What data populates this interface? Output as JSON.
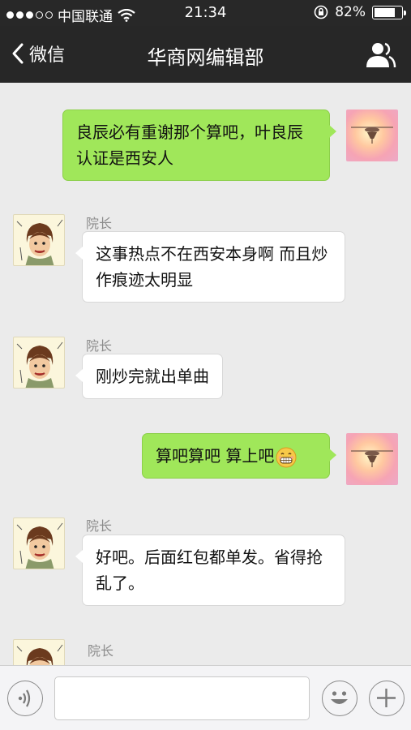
{
  "status_bar": {
    "carrier": "中国联通",
    "time": "21:34",
    "battery_percent": "82%",
    "battery_level": 0.82
  },
  "nav": {
    "back_label": "微信",
    "title": "华商网编辑部"
  },
  "messages": [
    {
      "direction": "outgoing",
      "text": "良辰必有重谢那个算吧，叶良辰认证是西安人"
    },
    {
      "direction": "incoming",
      "sender": "院长",
      "text": "这事热点不在西安本身啊 而且炒作痕迹太明显"
    },
    {
      "direction": "incoming",
      "sender": "院长",
      "text": "刚炒完就出单曲"
    },
    {
      "direction": "outgoing",
      "text": "算吧算吧 算上吧",
      "emoji": "grinning-face"
    },
    {
      "direction": "incoming",
      "sender": "院长",
      "text": "好吧。后面红包都单发。省得抢乱了。"
    },
    {
      "direction": "incoming",
      "sender": "院长",
      "text": ""
    }
  ],
  "input_bar": {
    "text_value": "",
    "icons": [
      "voice-icon",
      "emoji-icon",
      "plus-icon"
    ]
  },
  "colors": {
    "outgoing_bubble": "#a0e75a",
    "incoming_bubble": "#ffffff",
    "nav_background": "#272727",
    "chat_background": "#ebebeb"
  }
}
